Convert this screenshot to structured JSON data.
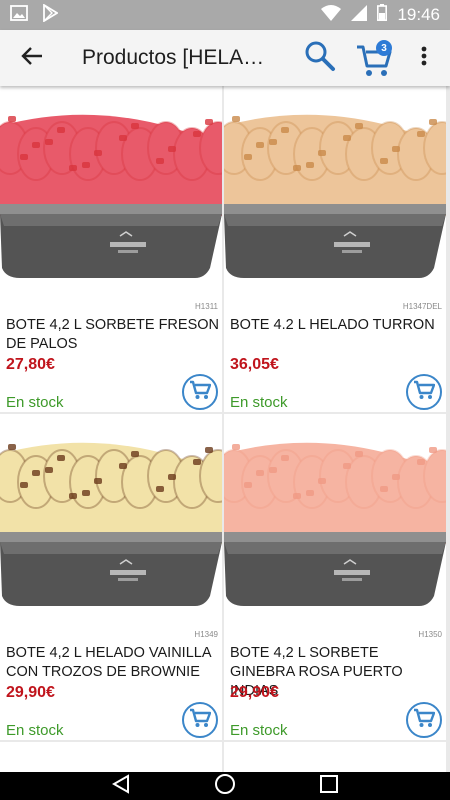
{
  "status_bar": {
    "time": "19:46",
    "icons": [
      "image-icon",
      "play-store-icon",
      "wifi-icon",
      "signal-icon",
      "battery-icon"
    ]
  },
  "app_bar": {
    "title": "Productos [HELA…",
    "back_icon": "arrow-left-icon",
    "search_icon": "search-icon",
    "cart_icon": "cart-icon",
    "cart_count": "3",
    "more_icon": "more-vert-icon"
  },
  "products": [
    {
      "code": "H1311",
      "name": "BOTE 4,2 L SORBETE FRESON DE PALOS",
      "price": "27,80€",
      "stock": "En stock",
      "image": "strawberry-sorbet-tub",
      "cream_color": "#e85a6a",
      "top_color": "#d8353d"
    },
    {
      "code": "H1347DEL",
      "name": "BOTE 4.2 L HELADO TURRON",
      "price": "36,05€",
      "stock": "En stock",
      "image": "turron-ice-cream-tub",
      "cream_color": "#edc59a",
      "top_color": "#c98a4a"
    },
    {
      "code": "H1349",
      "name": "BOTE 4,2 L HELADO VAINILLA CON TROZOS DE BROWNIE",
      "price": "29,90€",
      "stock": "En stock",
      "image": "vanilla-brownie-tub",
      "cream_color": "#f2e2a8",
      "top_color": "#6b3b1c"
    },
    {
      "code": "H1350",
      "name": "BOTE 4,2 L SORBETE GINEBRA ROSA PUERTO INDIAS",
      "price": "29,90€",
      "stock": "En stock",
      "image": "pink-gin-sorbet-tub",
      "cream_color": "#f6b4a2",
      "top_color": "#f09a85"
    }
  ],
  "colors": {
    "price": "#c0141c",
    "stock": "#3e9a2a",
    "accent": "#2e7bd6"
  }
}
